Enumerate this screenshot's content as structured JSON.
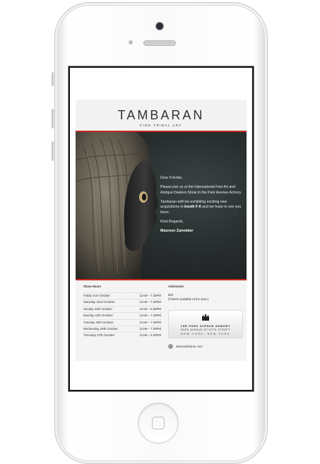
{
  "brand": {
    "name": "TAMBARAN",
    "tagline": "FINE TRIBAL ART"
  },
  "hero": {
    "greeting": "Dear Friends,",
    "paragraph1": "Please join us at the International Fine Art and Antique Dealers Show in the Park Avenue Armory.",
    "paragraph2_before": "Tambaran with be exhibiting exciting new acquisitions in",
    "paragraph2_bold": "booth F-6",
    "paragraph2_after": "and we hope to see you there.",
    "closing": "Kind Regards,",
    "signature": "Maureen Zarember"
  },
  "show_hours": {
    "title": "Show Hours",
    "rows": [
      {
        "day": "Friday 21st October:",
        "time": "11AM  –  7.30PM"
      },
      {
        "day": "Saturday 22nd October:",
        "time": "11AM  –  7.30PM"
      },
      {
        "day": "Sunday 23th October:",
        "time": "11AM  –  6.00PM"
      },
      {
        "day": "Monday 24th October:",
        "time": "11AM  –  7.30PM"
      },
      {
        "day": "Tuesday 25th October:",
        "time": "11AM  –  7.30PM"
      },
      {
        "day": "Wednesday 26th October:",
        "time": "11AM  –  7.30PM"
      },
      {
        "day": "Thursday 27th October:",
        "time": "11AM  –  6.00PM"
      }
    ]
  },
  "admission": {
    "title": "Admission",
    "price": "$20",
    "note": "(Tickets available at the door.)"
  },
  "venue": {
    "name": "THE PARK AVENUE ARMORY",
    "address": "PARK AVENUE AT 67TH STREET",
    "city": "NEW YORK, NEW YORK"
  },
  "website": "www.tambaran.com",
  "colors": {
    "accent_red": "#c62a1f",
    "hero_bg": "#252a2a",
    "phone_body": "#fafafa"
  },
  "icons": [
    "armory-building-icon",
    "globe-icon"
  ]
}
